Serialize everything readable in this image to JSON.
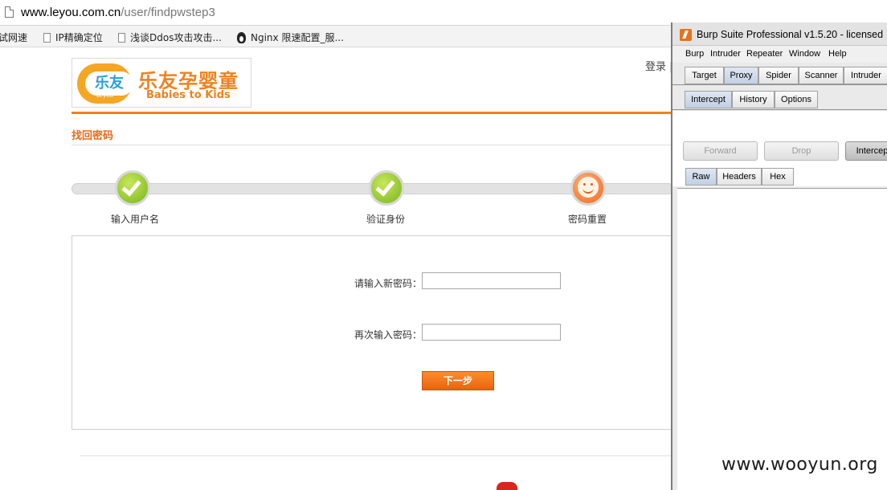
{
  "browser": {
    "url_host": "www.leyou.com.cn",
    "url_path": "/user/findpwstep3",
    "bookmarks": [
      "测试网速",
      "IP精确定位",
      "浅谈Ddos攻击攻击...",
      "Nginx 限速配置_服..."
    ]
  },
  "site": {
    "logo_mark_text": "乐友",
    "logo_mark_sub": "Leyou",
    "logo_cn": "乐友孕婴童",
    "logo_en": "Babies to Kids",
    "login_link": "登录 |",
    "section_title": "找回密码",
    "steps": [
      {
        "label": "输入用户名",
        "status": "done"
      },
      {
        "label": "验证身份",
        "status": "done"
      },
      {
        "label": "密码重置",
        "status": "current"
      }
    ],
    "form": {
      "new_password_label": "请输入新密码：",
      "new_password_value": "",
      "confirm_password_label": "再次输入密码：",
      "confirm_password_value": "",
      "next_button": "下一步"
    },
    "accent_color": "#f0821e"
  },
  "burp": {
    "title": "Burp Suite Professional v1.5.20 - licensed",
    "menus": [
      "Burp",
      "Intruder",
      "Repeater",
      "Window",
      "Help"
    ],
    "main_tabs": [
      {
        "label": "Target",
        "active": false
      },
      {
        "label": "Proxy",
        "active": true
      },
      {
        "label": "Spider",
        "active": false
      },
      {
        "label": "Scanner",
        "active": false
      },
      {
        "label": "Intruder",
        "active": false
      }
    ],
    "proxy_tabs": [
      {
        "label": "Intercept",
        "active": true
      },
      {
        "label": "History",
        "active": false
      },
      {
        "label": "Options",
        "active": false
      }
    ],
    "action_buttons": {
      "forward": "Forward",
      "drop": "Drop",
      "intercept": "Intercept"
    },
    "view_tabs": [
      {
        "label": "Raw",
        "active": true
      },
      {
        "label": "Headers",
        "active": false
      },
      {
        "label": "Hex",
        "active": false
      }
    ]
  },
  "watermark": "www.wooyun.org"
}
